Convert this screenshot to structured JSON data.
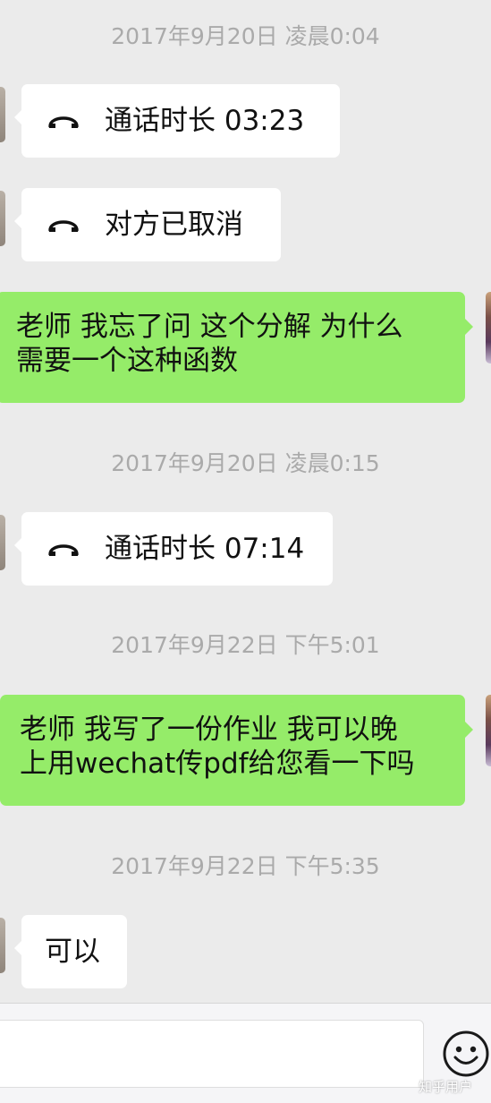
{
  "chat": {
    "ts1": "2017年9月20日 凌晨0:04",
    "call1": {
      "icon": "phone-hangup-icon",
      "text": "通话时长 03:23"
    },
    "call2": {
      "icon": "phone-hangup-icon",
      "text": "对方已取消"
    },
    "msg1": {
      "lines": [
        "老师 我忘了问 这个分解 为什么",
        "需要一个这种函数"
      ]
    },
    "ts2": "2017年9月20日 凌晨0:15",
    "call3": {
      "icon": "phone-hangup-icon",
      "text": "通话时长 07:14"
    },
    "ts3": "2017年9月22日 下午5:01",
    "msg2": {
      "lines": [
        "老师 我写了一份作业 我可以晚",
        "上用wechat传pdf给您看一下吗"
      ]
    },
    "ts4": "2017年9月22日 下午5:35",
    "msg3": {
      "text": "可以"
    }
  },
  "input_bar": {
    "emoji_icon": "emoji-smiley-icon"
  },
  "watermark": "知乎用户",
  "colors": {
    "background": "#ebebeb",
    "incoming_bubble": "#ffffff",
    "outgoing_bubble": "#95ec69",
    "timestamp": "#aaaaaa"
  }
}
